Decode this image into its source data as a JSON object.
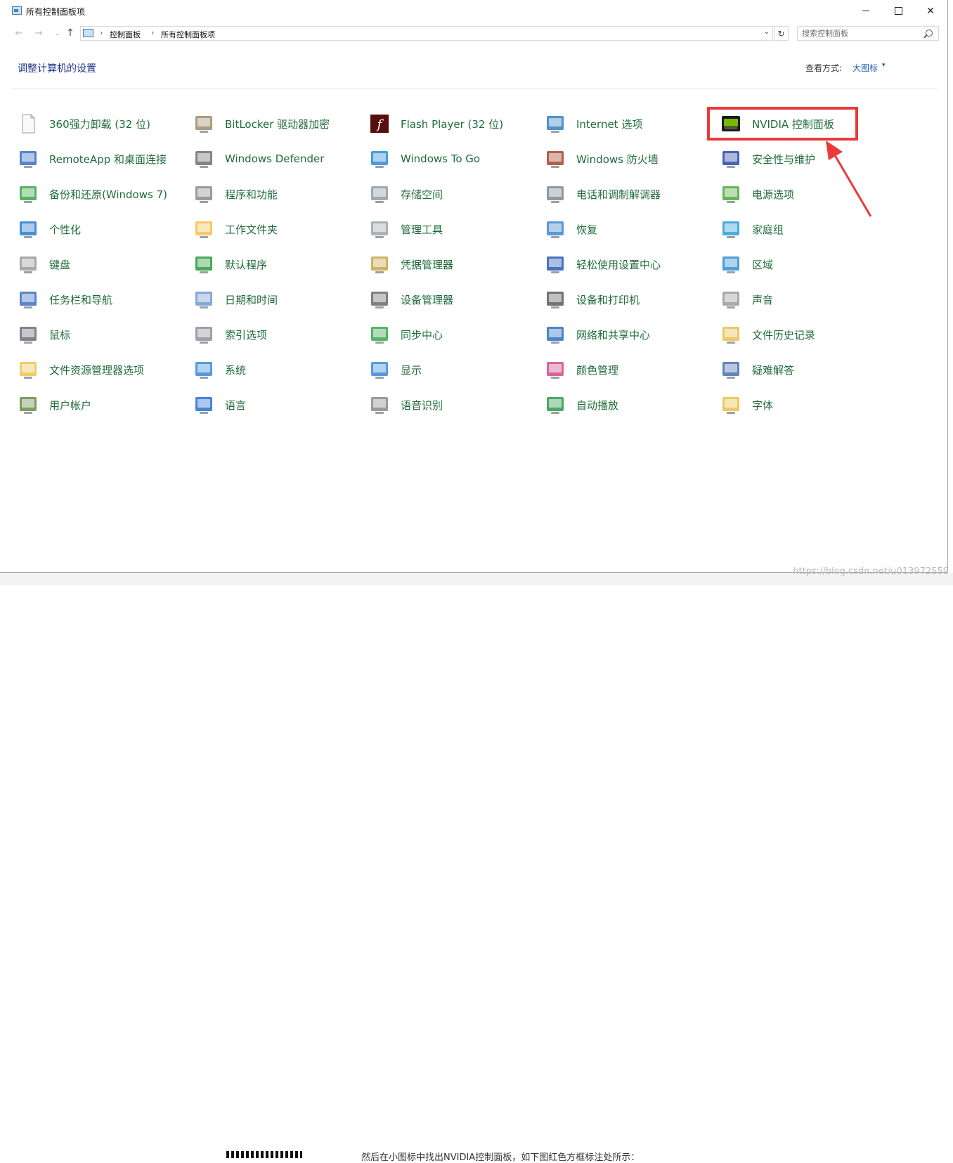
{
  "window": {
    "title": "所有控制面板项",
    "minimize": "—",
    "maximize": "□",
    "close": "✕"
  },
  "nav": {
    "back": "←",
    "forward": "→",
    "recent": "⌄",
    "up": "↑",
    "breadcrumb": [
      "控制面板",
      "所有控制面板项"
    ],
    "separator": "›",
    "dropdown": "⌄",
    "refresh": "↻",
    "search_placeholder": "搜索控制面板"
  },
  "header": {
    "title": "调整计算机的设置",
    "view_label": "查看方式:",
    "view_value": "大图标",
    "view_caret": "▾"
  },
  "colors": {
    "link_green": "#1f6b3a",
    "title_blue": "#1e3287",
    "highlight_red": "#ea3a3a"
  },
  "items": [
    {
      "label": "360强力卸载 (32 位)",
      "icon": "document-icon",
      "color": "#f4f4f4"
    },
    {
      "label": "BitLocker 驱动器加密",
      "icon": "bitlocker-icon",
      "color": "#9a8c6a"
    },
    {
      "label": "Flash Player (32 位)",
      "icon": "flash-player-icon",
      "color": "#7a1010"
    },
    {
      "label": "Internet 选项",
      "icon": "internet-options-icon",
      "color": "#2f7fc1"
    },
    {
      "label": "NVIDIA 控制面板",
      "icon": "nvidia-icon",
      "color": "#76b900"
    },
    {
      "label": "RemoteApp 和桌面连接",
      "icon": "remoteapp-icon",
      "color": "#3a6fc0"
    },
    {
      "label": "Windows Defender",
      "icon": "windows-defender-icon",
      "color": "#6e6e6e"
    },
    {
      "label": "Windows To Go",
      "icon": "windows-to-go-icon",
      "color": "#2b8bd8"
    },
    {
      "label": "Windows 防火墙",
      "icon": "firewall-icon",
      "color": "#a0452c"
    },
    {
      "label": "安全性与维护",
      "icon": "flag-icon",
      "color": "#2846a8"
    },
    {
      "label": "备份和还原(Windows 7)",
      "icon": "backup-icon",
      "color": "#3aa64a"
    },
    {
      "label": "程序和功能",
      "icon": "programs-icon",
      "color": "#8a8a8a"
    },
    {
      "label": "存储空间",
      "icon": "storage-icon",
      "color": "#8f9aa3"
    },
    {
      "label": "电话和调制解调器",
      "icon": "phone-modem-icon",
      "color": "#7d8790"
    },
    {
      "label": "电源选项",
      "icon": "power-options-icon",
      "color": "#4ea83a"
    },
    {
      "label": "个性化",
      "icon": "personalization-icon",
      "color": "#2a7bd1"
    },
    {
      "label": "工作文件夹",
      "icon": "work-folders-icon",
      "color": "#f2c14e"
    },
    {
      "label": "管理工具",
      "icon": "admin-tools-icon",
      "color": "#9aa5ad"
    },
    {
      "label": "恢复",
      "icon": "recovery-icon",
      "color": "#3f86c9"
    },
    {
      "label": "家庭组",
      "icon": "homegroup-icon",
      "color": "#2a9fd6"
    },
    {
      "label": "键盘",
      "icon": "keyboard-icon",
      "color": "#9a9a9a"
    },
    {
      "label": "默认程序",
      "icon": "default-programs-icon",
      "color": "#2a9a3a"
    },
    {
      "label": "凭据管理器",
      "icon": "credential-manager-icon",
      "color": "#c9a54a"
    },
    {
      "label": "轻松使用设置中心",
      "icon": "ease-of-access-icon",
      "color": "#2a5ab0"
    },
    {
      "label": "区域",
      "icon": "region-icon",
      "color": "#2f8fd0"
    },
    {
      "label": "任务栏和导航",
      "icon": "taskbar-icon",
      "color": "#3f6fc0"
    },
    {
      "label": "日期和时间",
      "icon": "date-time-icon",
      "color": "#6e9ad0"
    },
    {
      "label": "设备管理器",
      "icon": "device-manager-icon",
      "color": "#6a6a6a"
    },
    {
      "label": "设备和打印机",
      "icon": "printer-icon",
      "color": "#5a5a5a"
    },
    {
      "label": "声音",
      "icon": "speaker-icon",
      "color": "#9a9a9a"
    },
    {
      "label": "鼠标",
      "icon": "mouse-icon",
      "color": "#6a6f75"
    },
    {
      "label": "索引选项",
      "icon": "indexing-icon",
      "color": "#8a9098"
    },
    {
      "label": "同步中心",
      "icon": "sync-center-icon",
      "color": "#3aa64a"
    },
    {
      "label": "网络和共享中心",
      "icon": "network-icon",
      "color": "#2a6fc0"
    },
    {
      "label": "文件历史记录",
      "icon": "file-history-icon",
      "color": "#e9bf4a"
    },
    {
      "label": "文件资源管理器选项",
      "icon": "explorer-options-icon",
      "color": "#efc350"
    },
    {
      "label": "系统",
      "icon": "system-icon",
      "color": "#3a8ad8"
    },
    {
      "label": "显示",
      "icon": "display-icon",
      "color": "#3a8ad8"
    },
    {
      "label": "颜色管理",
      "icon": "color-management-icon",
      "color": "#d04a8a"
    },
    {
      "label": "疑难解答",
      "icon": "troubleshooting-icon",
      "color": "#4a6fb0"
    },
    {
      "label": "用户帐户",
      "icon": "user-accounts-icon",
      "color": "#6a8a4a"
    },
    {
      "label": "语言",
      "icon": "language-icon",
      "color": "#2a6fd0"
    },
    {
      "label": "语音识别",
      "icon": "microphone-icon",
      "color": "#8a8a8a"
    },
    {
      "label": "自动播放",
      "icon": "autoplay-icon",
      "color": "#2a9a4a"
    },
    {
      "label": "字体",
      "icon": "fonts-icon",
      "color": "#e9bf4a"
    }
  ],
  "background": {
    "watermark": "https://blog.csdn.net/u013972559",
    "below_text": "然后在小图标中找出NVIDIA控制面板，如下图红色方框标注处所示："
  }
}
